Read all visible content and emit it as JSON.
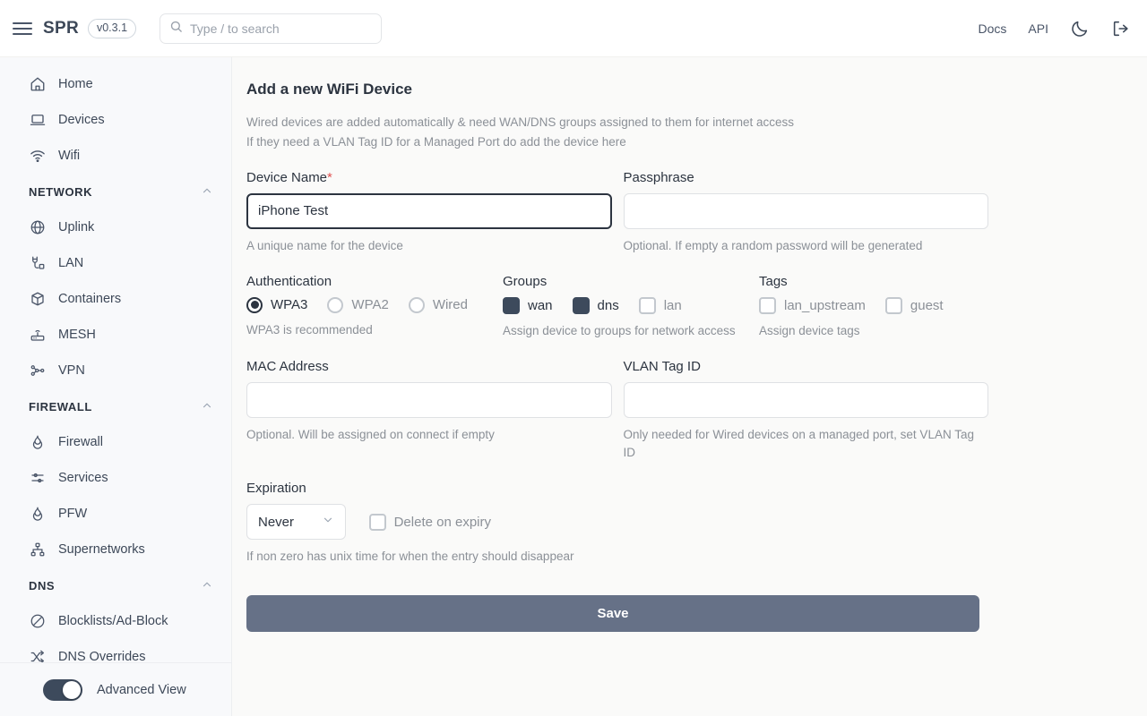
{
  "header": {
    "menu_icon": "hamburger-icon",
    "brand": "SPR",
    "version": "v0.3.1",
    "search": {
      "placeholder": "Type / to search",
      "value": "",
      "icon": "search-icon"
    },
    "docs_label": "Docs",
    "api_label": "API",
    "theme_icon": "moon-icon",
    "logout_icon": "logout-icon"
  },
  "sidebar": {
    "items": [
      {
        "label": "Home",
        "icon": "home-icon",
        "type": "item"
      },
      {
        "label": "Devices",
        "icon": "laptop-icon",
        "type": "item"
      },
      {
        "label": "Wifi",
        "icon": "wifi-icon",
        "type": "item"
      },
      {
        "label": "NETWORK",
        "icon": "chevron-up-icon",
        "type": "group"
      },
      {
        "label": "Uplink",
        "icon": "globe-icon",
        "type": "item"
      },
      {
        "label": "LAN",
        "icon": "cable-icon",
        "type": "item"
      },
      {
        "label": "Containers",
        "icon": "box-icon",
        "type": "item"
      },
      {
        "label": "MESH",
        "icon": "router-icon",
        "type": "item"
      },
      {
        "label": "VPN",
        "icon": "nodes-icon",
        "type": "item"
      },
      {
        "label": "FIREWALL",
        "icon": "chevron-up-icon",
        "type": "group"
      },
      {
        "label": "Firewall",
        "icon": "flame-icon",
        "type": "item"
      },
      {
        "label": "Services",
        "icon": "sliders-icon",
        "type": "item"
      },
      {
        "label": "PFW",
        "icon": "flame-icon",
        "type": "item"
      },
      {
        "label": "Supernetworks",
        "icon": "sitemap-icon",
        "type": "item"
      },
      {
        "label": "DNS",
        "icon": "chevron-up-icon",
        "type": "group"
      },
      {
        "label": "Blocklists/Ad-Block",
        "icon": "ban-icon",
        "type": "item"
      },
      {
        "label": "DNS Overrides",
        "icon": "shuffle-icon",
        "type": "item"
      }
    ],
    "footer": {
      "toggle_label": "Advanced View",
      "toggle_on": true
    }
  },
  "main": {
    "title": "Add a new WiFi Device",
    "desc_line1": "Wired devices are added automatically & need WAN/DNS groups assigned to them for internet access",
    "desc_line2": "If they need a VLAN Tag ID for a Managed Port do add the device here",
    "device_name": {
      "label": "Device Name",
      "required_mark": "*",
      "value": "iPhone Test",
      "placeholder": "",
      "hint": "A unique name for the device",
      "focused": true
    },
    "passphrase": {
      "label": "Passphrase",
      "value": "",
      "placeholder": "",
      "hint": "Optional. If empty a random password will be generated"
    },
    "authentication": {
      "label": "Authentication",
      "hint": "WPA3 is recommended",
      "options": [
        {
          "label": "WPA3",
          "selected": true
        },
        {
          "label": "WPA2",
          "selected": false
        },
        {
          "label": "Wired",
          "selected": false
        }
      ]
    },
    "groups": {
      "label": "Groups",
      "hint": "Assign device to groups for network access",
      "options": [
        {
          "label": "wan",
          "checked": true
        },
        {
          "label": "dns",
          "checked": true
        },
        {
          "label": "lan",
          "checked": false
        }
      ]
    },
    "tags": {
      "label": "Tags",
      "hint": "Assign device tags",
      "options": [
        {
          "label": "lan_upstream",
          "checked": false
        },
        {
          "label": "guest",
          "checked": false
        }
      ]
    },
    "mac_address": {
      "label": "MAC Address",
      "value": "",
      "placeholder": "",
      "hint": "Optional. Will be assigned on connect if empty"
    },
    "vlan_tag_id": {
      "label": "VLAN Tag ID",
      "value": "",
      "placeholder": "",
      "hint": "Only needed for Wired devices on a managed port, set VLAN Tag ID"
    },
    "expiration": {
      "label": "Expiration",
      "selected": "Never",
      "options": [
        "Never"
      ],
      "hint": "If non zero has unix time for when the entry should disappear",
      "delete_on_expiry": {
        "label": "Delete on expiry",
        "checked": false
      }
    },
    "save_label": "Save"
  },
  "colors": {
    "accent": "#3d4a5c",
    "save_button": "#667187",
    "required": "#e05252",
    "sidebar_bg": "#f8f9fb",
    "main_bg": "#fafaf9"
  }
}
